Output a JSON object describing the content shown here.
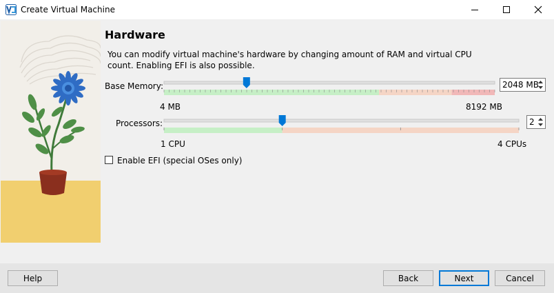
{
  "window": {
    "title": "Create Virtual Machine",
    "controls": [
      "minimize-icon",
      "maximize-icon",
      "close-icon"
    ]
  },
  "page": {
    "heading": "Hardware",
    "description": "You can modify virtual machine's hardware by changing amount of RAM and virtual CPU count. Enabling EFI is also possible."
  },
  "memory": {
    "label": "Base Memory:",
    "min_label": "4 MB",
    "max_label": "8192 MB",
    "value": "2048 MB",
    "value_mb": 2048,
    "min_mb": 4,
    "max_mb": 8192
  },
  "processors": {
    "label": "Processors:",
    "min_label": "1 CPU",
    "max_label": "4 CPUs",
    "value": "2",
    "min": 1,
    "max": 4
  },
  "efi": {
    "label": "Enable EFI (special OSes only)",
    "checked": false
  },
  "buttons": {
    "help": "Help",
    "back": "Back",
    "next": "Next",
    "cancel": "Cancel"
  },
  "colors": {
    "accent": "#0078d7",
    "slider_green": "#c6efc6",
    "slider_orange": "#f5d5c5",
    "slider_red": "#f1b8b8"
  }
}
